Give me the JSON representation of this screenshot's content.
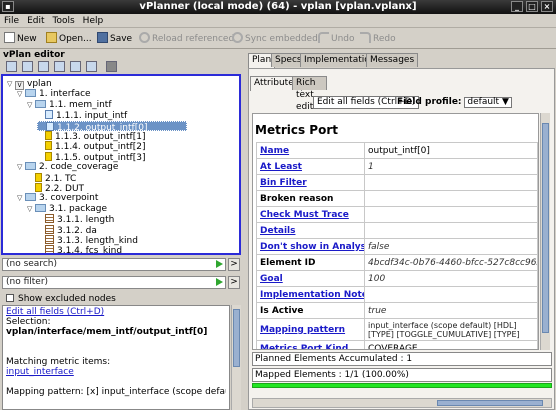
{
  "window": {
    "title": "vPlanner (local mode) (64) - vplan [vplan.vplanx]"
  },
  "menu": [
    "File",
    "Edit",
    "Tools",
    "Help"
  ],
  "toolbar": {
    "new": "New",
    "open": "Open...",
    "save": "Save",
    "reload": "Reload referenced",
    "sync": "Sync embedded",
    "undo": "Undo",
    "redo": "Redo"
  },
  "left": {
    "header": "vPlan editor",
    "tree": [
      {
        "label": "vplan",
        "icon": "vplan-icon",
        "level": 0,
        "expander": "▽"
      },
      {
        "label": "1. interface",
        "icon": "folder-icon",
        "level": 1,
        "expander": "▽"
      },
      {
        "label": "1.1. mem_intf",
        "icon": "folder-icon",
        "level": 2,
        "expander": "▽"
      },
      {
        "label": "1.1.1. input_intf",
        "icon": "metric-icon",
        "level": 3,
        "expander": ""
      },
      {
        "label": "1.1.2. output_intf[0]",
        "icon": "metric-icon",
        "level": 3,
        "expander": "",
        "selected": true
      },
      {
        "label": "1.1.3. output_intf[1]",
        "icon": "coverage-icon",
        "level": 3,
        "expander": ""
      },
      {
        "label": "1.1.4. output_intf[2]",
        "icon": "coverage-icon",
        "level": 3,
        "expander": ""
      },
      {
        "label": "1.1.5. output_intf[3]",
        "icon": "coverage-icon",
        "level": 3,
        "expander": ""
      },
      {
        "label": "2. code_coverage",
        "icon": "folder-icon",
        "level": 1,
        "expander": "▽"
      },
      {
        "label": "2.1. TC",
        "icon": "coverage-icon",
        "level": 2,
        "expander": ""
      },
      {
        "label": "2.2. DUT",
        "icon": "coverage-icon",
        "level": 2,
        "expander": ""
      },
      {
        "label": "3. coverpoint",
        "icon": "folder-icon",
        "level": 1,
        "expander": "▽"
      },
      {
        "label": "3.1. package",
        "icon": "folder-icon",
        "level": 2,
        "expander": "▽"
      },
      {
        "label": "3.1.1. length",
        "icon": "package-icon",
        "level": 3,
        "expander": ""
      },
      {
        "label": "3.1.2. da",
        "icon": "package-icon",
        "level": 3,
        "expander": ""
      },
      {
        "label": "3.1.3. length_kind",
        "icon": "package-icon",
        "level": 3,
        "expander": ""
      },
      {
        "label": "3.1.4. fcs_kind",
        "icon": "package-icon",
        "level": 3,
        "expander": ""
      }
    ],
    "search": "(no search)",
    "filter": "(no filter)",
    "show_excluded": "Show excluded nodes",
    "info": {
      "edit_link": "Edit all fields (Ctrl+D)",
      "selection_label": "Selection:",
      "selection_path": "vplan/interface/mem_intf/output_intf[0]",
      "matching_label": "Matching metric items:",
      "matching_item": "input_interface",
      "mapping_line": "Mapping pattern: [x] input_interface (scope default)"
    }
  },
  "right": {
    "tabs": [
      "Plan",
      "Specs",
      "Implementation",
      "Messages"
    ],
    "subtabs": [
      "Attributes",
      "Rich text editor"
    ],
    "edit_all_button": "Edit all fields (Ctrl+D)",
    "field_profile_label": "Field profile:",
    "field_profile_value": "default",
    "title": "Metrics Port",
    "rows": [
      {
        "key": "Name",
        "link": true,
        "value": "output_intf[0]",
        "style": "plain"
      },
      {
        "key": "At Least",
        "link": true,
        "value": "1",
        "style": "italic"
      },
      {
        "key": "Bin Filter",
        "link": true,
        "value": "",
        "style": "plain"
      },
      {
        "key": "Broken reason",
        "link": false,
        "value": "",
        "style": "plain"
      },
      {
        "key": "Check Must Trace",
        "link": true,
        "value": "",
        "style": "plain"
      },
      {
        "key": "Details",
        "link": true,
        "value": "",
        "style": "plain"
      },
      {
        "key": "Don't show in Analysis",
        "link": true,
        "value": "false",
        "style": "italic"
      },
      {
        "key": "Element ID",
        "link": false,
        "value": "4bcdf34c-0b76-4460-bfcc-527c8cc963c3",
        "style": "italic"
      },
      {
        "key": "Goal",
        "link": true,
        "value": "100",
        "style": "italic"
      },
      {
        "key": "Implementation Note",
        "link": true,
        "value": "",
        "style": "plain"
      },
      {
        "key": "Is Active",
        "link": false,
        "value": "true",
        "style": "italic"
      },
      {
        "key": "Mapping pattern",
        "link": true,
        "value": "input_interface (scope default) [HDL] [TYPE] [TOGGLE_CUMULATIVE] [TYPE]",
        "style": "small"
      },
      {
        "key": "Metrics Port Kind",
        "link": true,
        "value": "COVERAGE",
        "style": "plain"
      }
    ],
    "planned_status": "Planned Elements Accumulated : 1",
    "mapped_status": "Mapped Elements : 1/1 (100.00%)",
    "mapped_progress": 1.0
  },
  "colors": {
    "tree_border": "#2b2bd8",
    "selection": "#6c93c6",
    "link": "#1a1ac8",
    "progress": "#22e622"
  }
}
